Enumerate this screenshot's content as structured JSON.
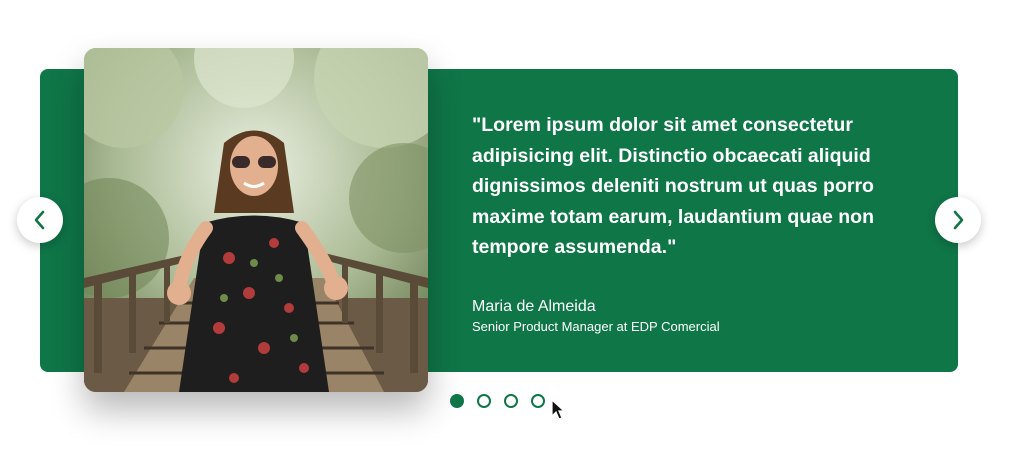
{
  "testimonial": {
    "quote": "\"Lorem ipsum dolor sit amet consectetur adipisicing elit. Distinctio obcaecati aliquid dignissimos deleniti nostrum ut quas porro maxime totam earum, laudantium quae non tempore assumenda.\"",
    "author_name": "Maria de Almeida",
    "author_role": "Senior Product Manager at EDP Comercial"
  },
  "carousel": {
    "prev_icon": "chevron-left-icon",
    "next_icon": "chevron-right-icon",
    "slide_count": 4,
    "active_index": 0
  },
  "colors": {
    "accent": "#0f7648",
    "background": "#ffffff"
  }
}
